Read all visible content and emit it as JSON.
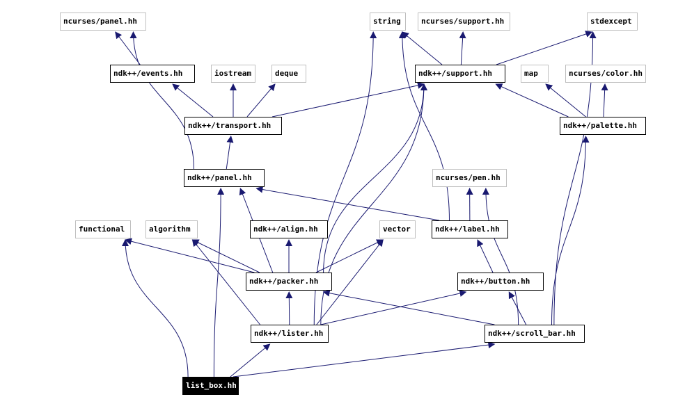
{
  "diagram": {
    "type": "include-dependency-graph",
    "edge_color": "#191970",
    "external_border_color": "#bfbfbf",
    "internal_border_color": "#000000",
    "focus_fill": "#000000",
    "nodes": [
      {
        "id": "ncurses_panel",
        "label": "ncurses/panel.hh",
        "kind": "external"
      },
      {
        "id": "string",
        "label": "string",
        "kind": "external"
      },
      {
        "id": "ncurses_support",
        "label": "ncurses/support.hh",
        "kind": "external"
      },
      {
        "id": "stdexcept",
        "label": "stdexcept",
        "kind": "external"
      },
      {
        "id": "ndk_events",
        "label": "ndk++/events.hh",
        "kind": "internal"
      },
      {
        "id": "iostream",
        "label": "iostream",
        "kind": "external"
      },
      {
        "id": "deque",
        "label": "deque",
        "kind": "external"
      },
      {
        "id": "ndk_support",
        "label": "ndk++/support.hh",
        "kind": "internal"
      },
      {
        "id": "map",
        "label": "map",
        "kind": "external"
      },
      {
        "id": "ncurses_color",
        "label": "ncurses/color.hh",
        "kind": "external"
      },
      {
        "id": "ndk_transport",
        "label": "ndk++/transport.hh",
        "kind": "internal"
      },
      {
        "id": "ndk_palette",
        "label": "ndk++/palette.hh",
        "kind": "internal"
      },
      {
        "id": "ndk_panel",
        "label": "ndk++/panel.hh",
        "kind": "internal"
      },
      {
        "id": "ncurses_pen",
        "label": "ncurses/pen.hh",
        "kind": "external"
      },
      {
        "id": "functional",
        "label": "functional",
        "kind": "external"
      },
      {
        "id": "algorithm",
        "label": "algorithm",
        "kind": "external"
      },
      {
        "id": "ndk_align",
        "label": "ndk++/align.hh",
        "kind": "internal"
      },
      {
        "id": "vector",
        "label": "vector",
        "kind": "external"
      },
      {
        "id": "ndk_label",
        "label": "ndk++/label.hh",
        "kind": "internal"
      },
      {
        "id": "ndk_packer",
        "label": "ndk++/packer.hh",
        "kind": "internal"
      },
      {
        "id": "ndk_button",
        "label": "ndk++/button.hh",
        "kind": "internal"
      },
      {
        "id": "ndk_lister",
        "label": "ndk++/lister.hh",
        "kind": "internal"
      },
      {
        "id": "ndk_scroll_bar",
        "label": "ndk++/scroll_bar.hh",
        "kind": "internal"
      },
      {
        "id": "list_box",
        "label": "list_box.hh",
        "kind": "focus"
      }
    ],
    "edges": [
      {
        "from": "ndk_events",
        "to": "ncurses_panel"
      },
      {
        "from": "ndk_panel",
        "to": "ncurses_panel"
      },
      {
        "from": "ndk_transport",
        "to": "ndk_events"
      },
      {
        "from": "ndk_transport",
        "to": "iostream"
      },
      {
        "from": "ndk_transport",
        "to": "deque"
      },
      {
        "from": "ndk_transport",
        "to": "ndk_support"
      },
      {
        "from": "ndk_support",
        "to": "string"
      },
      {
        "from": "ndk_support",
        "to": "ncurses_support"
      },
      {
        "from": "ndk_support",
        "to": "stdexcept"
      },
      {
        "from": "ndk_palette",
        "to": "ndk_support"
      },
      {
        "from": "ndk_palette",
        "to": "map"
      },
      {
        "from": "ndk_palette",
        "to": "ncurses_color"
      },
      {
        "from": "ndk_panel",
        "to": "ndk_transport"
      },
      {
        "from": "ndk_label",
        "to": "ndk_panel"
      },
      {
        "from": "ndk_label",
        "to": "ncurses_pen"
      },
      {
        "from": "ndk_label",
        "to": "string"
      },
      {
        "from": "ndk_packer",
        "to": "ndk_panel"
      },
      {
        "from": "ndk_packer",
        "to": "functional"
      },
      {
        "from": "ndk_packer",
        "to": "algorithm"
      },
      {
        "from": "ndk_packer",
        "to": "ndk_align"
      },
      {
        "from": "ndk_packer",
        "to": "vector"
      },
      {
        "from": "ndk_packer",
        "to": "ndk_support"
      },
      {
        "from": "ndk_button",
        "to": "ndk_label"
      },
      {
        "from": "ndk_lister",
        "to": "ndk_packer"
      },
      {
        "from": "ndk_lister",
        "to": "algorithm"
      },
      {
        "from": "ndk_lister",
        "to": "vector"
      },
      {
        "from": "ndk_lister",
        "to": "ndk_button"
      },
      {
        "from": "ndk_lister",
        "to": "ndk_support"
      },
      {
        "from": "ndk_lister",
        "to": "string"
      },
      {
        "from": "ndk_scroll_bar",
        "to": "ndk_packer"
      },
      {
        "from": "ndk_scroll_bar",
        "to": "ndk_button"
      },
      {
        "from": "ndk_scroll_bar",
        "to": "ncurses_pen"
      },
      {
        "from": "ndk_scroll_bar",
        "to": "ndk_palette"
      },
      {
        "from": "ndk_scroll_bar",
        "to": "stdexcept"
      },
      {
        "from": "list_box",
        "to": "ndk_lister"
      },
      {
        "from": "list_box",
        "to": "ndk_scroll_bar"
      },
      {
        "from": "list_box",
        "to": "functional"
      },
      {
        "from": "list_box",
        "to": "ndk_panel"
      }
    ]
  }
}
